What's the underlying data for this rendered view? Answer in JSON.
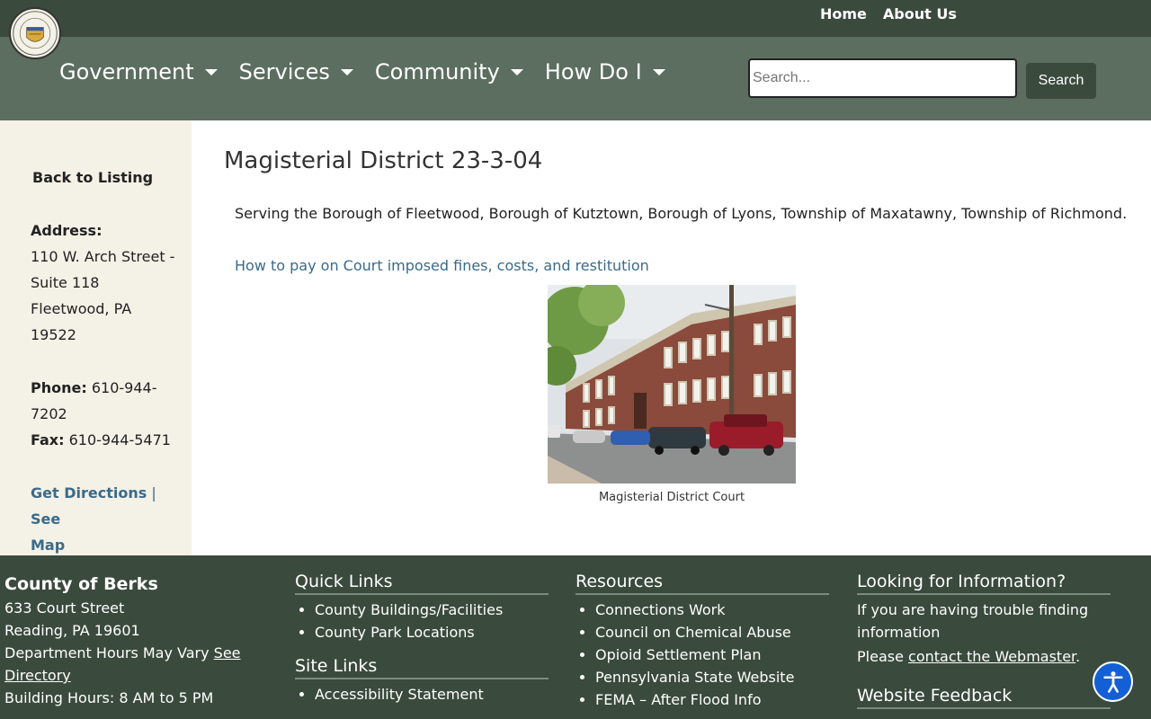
{
  "top_links": [
    "Home",
    "About Us"
  ],
  "nav": [
    "Government",
    "Services",
    "Community",
    "How Do I"
  ],
  "search": {
    "placeholder": "Search...",
    "button": "Search"
  },
  "sidebar": {
    "back": "Back to Listing",
    "address_label": "Address:",
    "address_lines": [
      "110 W. Arch Street -",
      "Suite 118",
      "Fleetwood, PA",
      "19522"
    ],
    "phone_label": "Phone:",
    "phone_value": " 610-944-",
    "phone_value2": "7202",
    "fax_label": "Fax:",
    "fax_value": " 610-944-5471",
    "directions": "Get Directions",
    "separator": " | ",
    "map_a": "See",
    "map_b": "Map"
  },
  "main": {
    "title": "Magisterial District 23-3-04",
    "serving": "Serving the Borough of Fleetwood, Borough of Kutztown, Borough of Lyons, Township of Maxatawny, Township of Richmond.",
    "pay_link": "How to pay on Court imposed fines, costs, and restitution",
    "caption": "Magisterial District Court"
  },
  "footer": {
    "org": {
      "name": "County of Berks",
      "street": "633 Court Street",
      "city": "Reading, PA 19601",
      "hours_note": "Department Hours May Vary ",
      "see": "See",
      "directory": "Directory",
      "building_hours": "Building Hours: 8 AM to 5 PM"
    },
    "quick_links": {
      "title": "Quick Links",
      "items": [
        "County Buildings/Facilities",
        "County Park Locations"
      ]
    },
    "site_links": {
      "title": "Site Links",
      "items": [
        "Accessibility Statement"
      ]
    },
    "resources": {
      "title": "Resources",
      "items": [
        "Connections Work",
        "Council on Chemical Abuse",
        "Opioid Settlement Plan",
        "Pennsylvania State Website",
        "FEMA – After Flood Info"
      ]
    },
    "info": {
      "title": "Looking for Information?",
      "text1": "If you are having trouble finding",
      "text2": "information",
      "please": "Please ",
      "contact": "contact the Webmaster",
      "period": ".",
      "feedback_title": "Website Feedback"
    }
  },
  "colors": {
    "topbar": "#3a4a3c",
    "navband": "#5c6e5f",
    "sidebar": "#f4f1e6",
    "link": "#3a6a8a",
    "a11y": "#1360d6"
  },
  "icons": {
    "seal": "county-seal-icon",
    "accessibility": "accessibility-icon"
  }
}
